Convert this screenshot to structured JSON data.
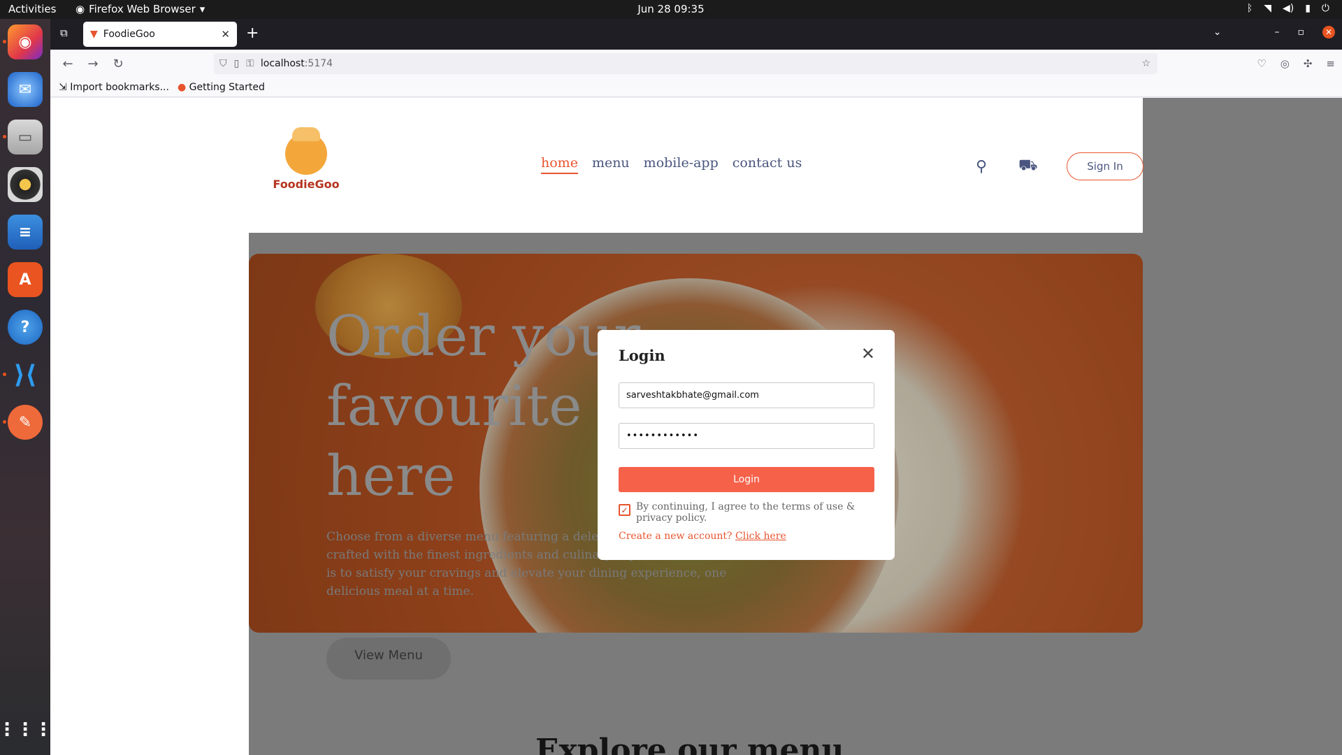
{
  "topbar": {
    "activities": "Activities",
    "app_name": "Firefox Web Browser",
    "clock": "Jun 28  09:35"
  },
  "browser": {
    "tab_title": "FoodieGoo",
    "url_host": "localhost",
    "url_port": ":5174",
    "bookmarks": [
      "Import bookmarks...",
      "Getting Started"
    ]
  },
  "site": {
    "logo_text": "FoodieGoo",
    "nav": [
      "home",
      "menu",
      "mobile-app",
      "contact us"
    ],
    "active_nav": "home",
    "sign_in": "Sign In",
    "hero_title": "Order your favourite food here",
    "hero_desc": "Choose from a diverse menu featuring a delectable array of dishes crafted with the finest ingredients and culinary expertise. Our mission is to satisfy your cravings and elevate your dining experience, one delicious meal at a time.",
    "view_menu": "View Menu",
    "explore_heading": "Explore our menu"
  },
  "login": {
    "title": "Login",
    "email": "sarveshtakbhate@gmail.com",
    "password_mask": "••••••••••••",
    "button": "Login",
    "terms": "By continuing, I agree to the terms of use & privacy policy.",
    "terms_checked": true,
    "create_prompt": "Create a new account?",
    "create_link": "Click here"
  },
  "colors": {
    "accent": "#e8542e",
    "login_button": "#f6614a",
    "nav_text": "#49557e"
  }
}
